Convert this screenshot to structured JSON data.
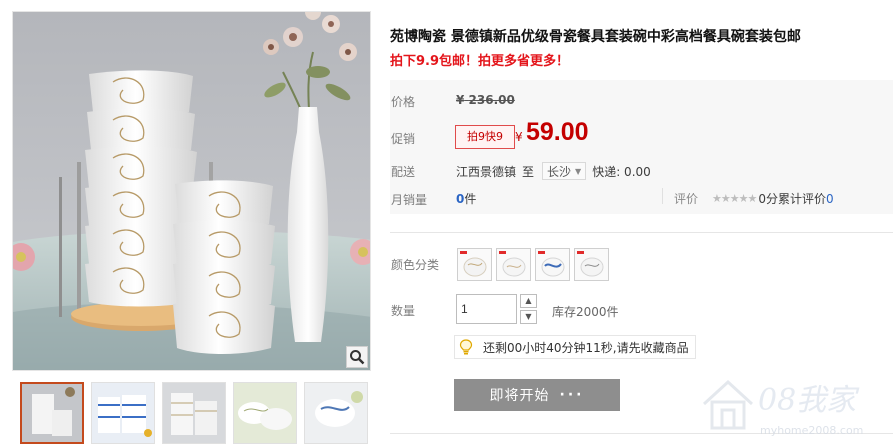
{
  "product": {
    "title": "苑博陶瓷 景德镇新品优级骨瓷餐具套装碗中彩高档餐具碗套装包邮",
    "subtitle": "拍下9.9包邮！拍更多省更多！"
  },
  "price": {
    "label": "价格",
    "original_yen": "¥",
    "original_value": "236.00"
  },
  "promo": {
    "label": "促销",
    "tag": "拍9快9",
    "yen": "¥",
    "value": "59.00"
  },
  "shipping": {
    "label": "配送",
    "origin": "江西景德镇",
    "to": "至",
    "city": "长沙",
    "express": "快递: 0.00"
  },
  "sales": {
    "label": "月销量",
    "count": "0",
    "unit": "件",
    "rating_label": "评价",
    "rating_score": "0分",
    "review_label": "累计评价",
    "review_count": "0"
  },
  "options": {
    "color_label": "颜色分类",
    "swatch_count": 4
  },
  "quantity": {
    "label": "数量",
    "value": "1",
    "stock": "库存2000件"
  },
  "tip": {
    "text": "还剩00小时40分钟11秒,请先收藏商品"
  },
  "buy": {
    "label": "即将开始",
    "dots": "···"
  },
  "watermark": {
    "brand": "08我家",
    "url": "myhome2008.com"
  },
  "colors": {
    "price_red": "#c40000",
    "title_red": "#e4151b",
    "link_blue": "#2b65c4",
    "button_gray": "#8e8e8e"
  }
}
